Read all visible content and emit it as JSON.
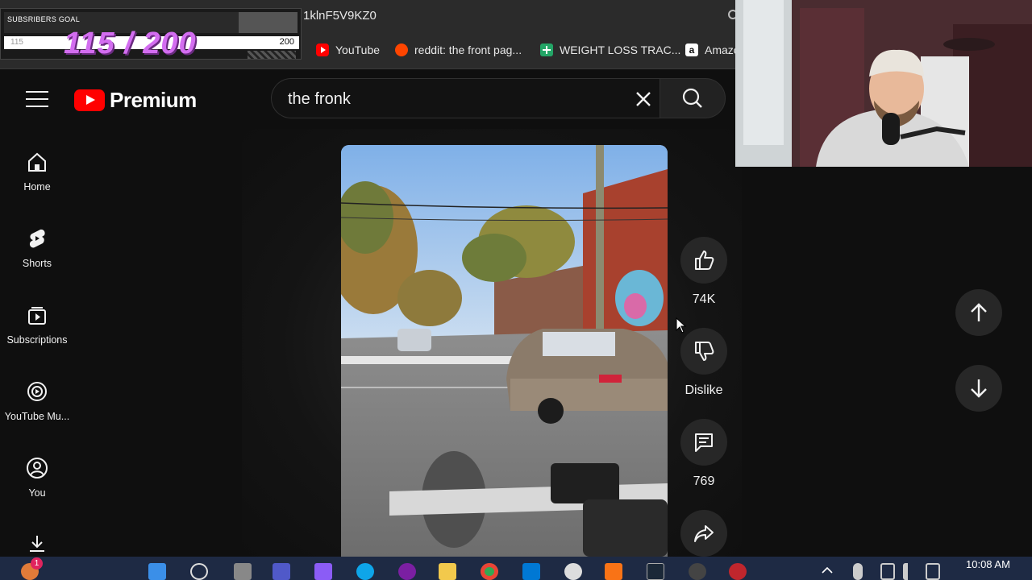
{
  "browser": {
    "url_fragment": "1klnF5V9KZ0",
    "bookmarks": [
      {
        "label": "YouTube",
        "icon": "youtube-icon",
        "color": "#ff0000"
      },
      {
        "label": "reddit: the front pag...",
        "icon": "reddit-icon",
        "color": "#ff4500"
      },
      {
        "label": "WEIGHT LOSS TRAC...",
        "icon": "sheets-icon",
        "color": "#23a566"
      },
      {
        "label": "Amazo",
        "icon": "amazon-icon",
        "color": "#ffffff"
      }
    ]
  },
  "goal_overlay": {
    "label": "SUBSRIBERS GOAL",
    "current": "115",
    "count_display": "115 / 200",
    "max": "200",
    "progress_fraction": 0.575
  },
  "header": {
    "logo_text": "Premium",
    "search_value": "the fronk"
  },
  "sidebar": {
    "items": [
      {
        "label": "Home",
        "icon": "home-icon"
      },
      {
        "label": "Shorts",
        "icon": "shorts-icon"
      },
      {
        "label": "Subscriptions",
        "icon": "subscriptions-icon"
      },
      {
        "label": "YouTube Mu...",
        "icon": "youtube-music-icon"
      },
      {
        "label": "You",
        "icon": "you-icon"
      },
      {
        "label": "",
        "icon": "download-icon"
      }
    ]
  },
  "actions": {
    "like_count": "74K",
    "dislike_label": "Dislike",
    "comment_count": "769"
  },
  "taskbar": {
    "time": "10:08 AM",
    "notification_count": "1"
  },
  "colors": {
    "background": "#0f0f0f",
    "brand_red": "#ff0000",
    "button_bg": "#272727",
    "goal_purple": "#d36df0"
  }
}
